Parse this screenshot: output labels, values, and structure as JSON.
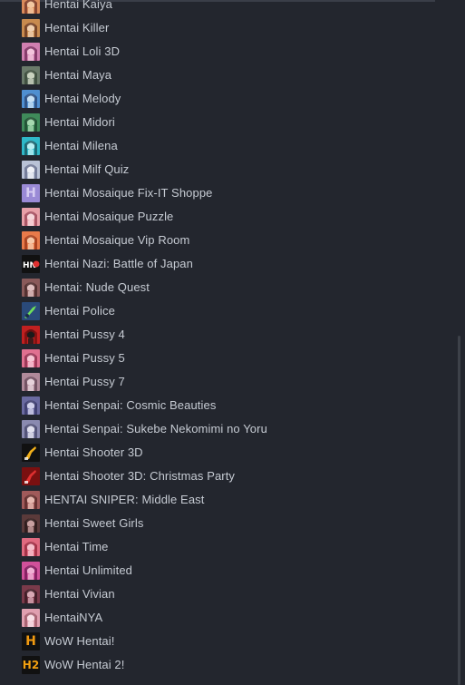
{
  "game_list": {
    "items": [
      {
        "label": "Hentai Kaiya",
        "icon": "anime-portrait-icon",
        "colors": [
          "#d98a5a",
          "#f2c6a0",
          "#7a3a2a"
        ]
      },
      {
        "label": "Hentai Killer",
        "icon": "anime-portrait-icon",
        "colors": [
          "#c78a4e",
          "#f0d0b0",
          "#6b3a22"
        ]
      },
      {
        "label": "Hentai Loli 3D",
        "icon": "anime-portrait-icon",
        "colors": [
          "#d07fb0",
          "#f3c4dc",
          "#7a3060"
        ]
      },
      {
        "label": "Hentai Maya",
        "icon": "anime-portrait-icon",
        "colors": [
          "#6a7a6a",
          "#c9d2bf",
          "#3a4a3a"
        ]
      },
      {
        "label": "Hentai Melody",
        "icon": "anime-portrait-icon",
        "colors": [
          "#4f8fd0",
          "#c6e0f4",
          "#2a4a7a"
        ]
      },
      {
        "label": "Hentai Midori",
        "icon": "anime-portrait-icon",
        "colors": [
          "#3f8a5a",
          "#a6d8b0",
          "#1f4a30"
        ]
      },
      {
        "label": "Hentai Milena",
        "icon": "anime-portrait-icon",
        "colors": [
          "#2fb8c8",
          "#b8eef2",
          "#1a5a66"
        ]
      },
      {
        "label": "Hentai Milf Quiz",
        "icon": "anime-portrait-icon",
        "colors": [
          "#b9c2d6",
          "#eef0f6",
          "#6a7290"
        ]
      },
      {
        "label": "Hentai Mosaique Fix-IT Shoppe",
        "icon": "letter-h-icon",
        "colors": [
          "#9a8ad6",
          "#d6ccf2",
          "#5a4aa0"
        ]
      },
      {
        "label": "Hentai Mosaique Puzzle",
        "icon": "anime-portrait-icon",
        "colors": [
          "#e8a0a8",
          "#f6d6da",
          "#a04a5a"
        ]
      },
      {
        "label": "Hentai Mosaique Vip Room",
        "icon": "anime-portrait-icon",
        "colors": [
          "#e87a4a",
          "#f6c8a8",
          "#a03a1a"
        ]
      },
      {
        "label": "Hentai Nazi: Battle of Japan",
        "icon": "hn-logo-icon",
        "colors": [
          "#111111",
          "#e03030",
          "#ffffff"
        ]
      },
      {
        "label": "Hentai: Nude Quest",
        "icon": "anime-portrait-icon",
        "colors": [
          "#8a5a5a",
          "#e0c0c0",
          "#4a2a2a"
        ]
      },
      {
        "label": "Hentai Police",
        "icon": "police-badge-icon",
        "colors": [
          "#2a4a7a",
          "#6fe05a",
          "#1a2a4a"
        ]
      },
      {
        "label": "Hentai Pussy 4",
        "icon": "anime-portrait-icon",
        "colors": [
          "#c02020",
          "#1a1a1a",
          "#7a1010"
        ]
      },
      {
        "label": "Hentai Pussy 5",
        "icon": "anime-portrait-icon",
        "colors": [
          "#e07090",
          "#f6c6d4",
          "#903050"
        ]
      },
      {
        "label": "Hentai Pussy 7",
        "icon": "anime-portrait-icon",
        "colors": [
          "#b08a9a",
          "#e6d2da",
          "#6a4a5a"
        ]
      },
      {
        "label": "Hentai Senpai: Cosmic Beauties",
        "icon": "anime-portrait-icon",
        "colors": [
          "#6a6aa0",
          "#d0d0ea",
          "#3a3a6a"
        ]
      },
      {
        "label": "Hentai Senpai: Sukebe Nekomimi no Yoru",
        "icon": "anime-portrait-icon",
        "colors": [
          "#8a8ab0",
          "#e0e0ee",
          "#4a4a70"
        ]
      },
      {
        "label": "Hentai Shooter 3D",
        "icon": "gun-icon",
        "colors": [
          "#111111",
          "#f2b01a",
          "#ffffff"
        ]
      },
      {
        "label": "Hentai Shooter 3D: Christmas Party",
        "icon": "gun-icon",
        "colors": [
          "#7a1010",
          "#e03030",
          "#ffffff"
        ]
      },
      {
        "label": "HENTAI SNIPER: Middle East",
        "icon": "anime-portrait-icon",
        "colors": [
          "#a05a5a",
          "#e6b8b0",
          "#5a2a2a"
        ]
      },
      {
        "label": "Hentai Sweet Girls",
        "icon": "anime-portrait-icon",
        "colors": [
          "#5a3a3a",
          "#c8a0a0",
          "#2a1a1a"
        ]
      },
      {
        "label": "Hentai Time",
        "icon": "anime-portrait-icon",
        "colors": [
          "#e06a80",
          "#f6c0cc",
          "#9a2a40"
        ]
      },
      {
        "label": "Hentai Unlimited",
        "icon": "anime-portrait-icon",
        "colors": [
          "#d0509a",
          "#f0b0d4",
          "#7a1a5a"
        ]
      },
      {
        "label": "Hentai Vivian",
        "icon": "anime-portrait-icon",
        "colors": [
          "#7a3a4a",
          "#d8a8b4",
          "#3a1a22"
        ]
      },
      {
        "label": "HentaiNYA",
        "icon": "anime-portrait-icon",
        "colors": [
          "#e0a0b0",
          "#f8e0e6",
          "#a05a6a"
        ]
      },
      {
        "label": "WoW Hentai!",
        "icon": "letter-h-icon",
        "colors": [
          "#111111",
          "#f29a10",
          "#000000"
        ]
      },
      {
        "label": "WoW Hentai 2!",
        "icon": "h2-logo-icon",
        "colors": [
          "#111111",
          "#f2a010",
          "#000000"
        ]
      }
    ]
  }
}
